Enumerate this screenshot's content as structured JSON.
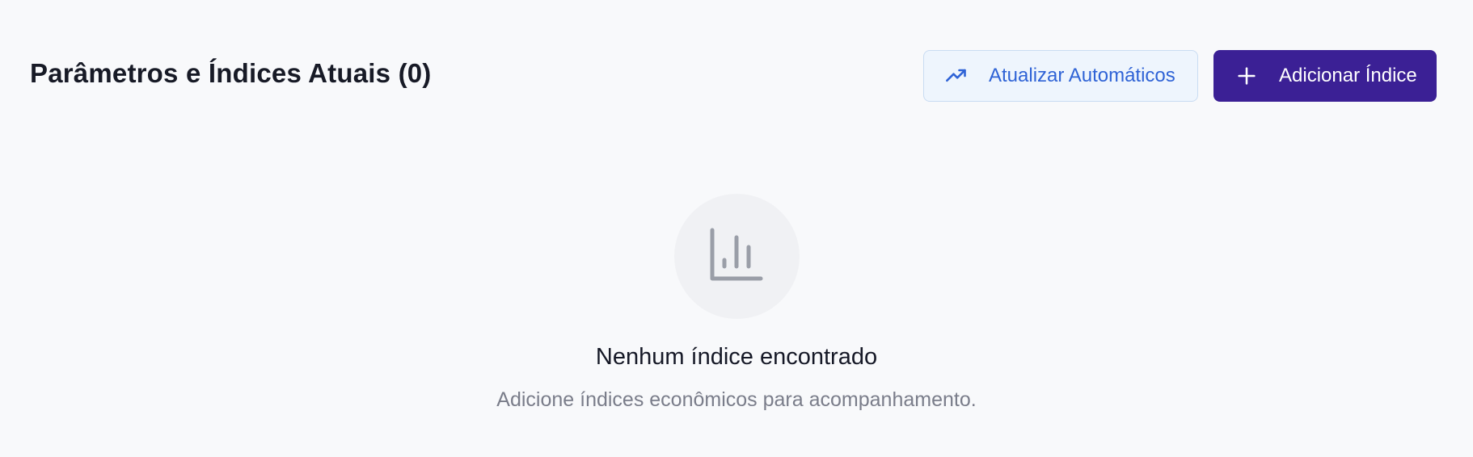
{
  "header": {
    "title": "Parâmetros e Índices Atuais (0)",
    "auto_update_button": {
      "label": "Atualizar Automáticos",
      "icon": "trending-up-icon"
    },
    "add_button": {
      "label": "Adicionar Índice",
      "icon": "plus-icon"
    }
  },
  "empty_state": {
    "icon": "bar-chart-icon",
    "title": "Nenhum índice encontrado",
    "subtitle": "Adicione índices econômicos para acompanhamento."
  },
  "colors": {
    "background": "#f8f9fb",
    "primary": "#3b2095",
    "secondary_bg": "#eef5fd",
    "secondary_text": "#2f63d6",
    "muted_icon": "#9a9ea8"
  }
}
